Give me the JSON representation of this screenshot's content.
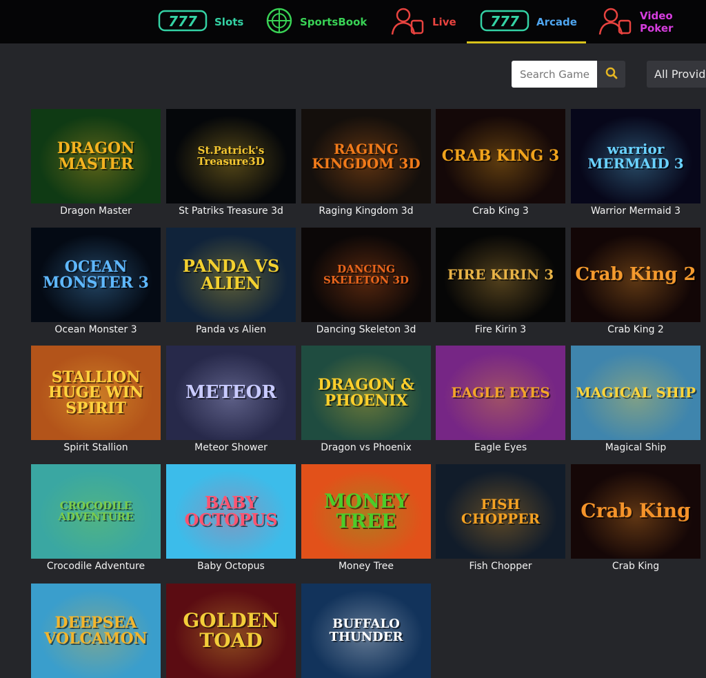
{
  "nav": {
    "items": [
      {
        "label": "Slots",
        "color": "#34d2a4"
      },
      {
        "label": "SportsBook",
        "color": "#39d255"
      },
      {
        "label": "Live",
        "color": "#e8433f"
      },
      {
        "label": "Arcade",
        "color": "#4fa6f0"
      },
      {
        "label": "Video Poker",
        "color": "#d63dde"
      }
    ],
    "active": "Arcade"
  },
  "toolbar": {
    "search_placeholder": "Search Game",
    "provider_label": "All Providers"
  },
  "games": [
    {
      "name": "Dragon Master",
      "art": "DRAGON MASTER",
      "bg": "#0f3a14",
      "accent": "#f4b21f"
    },
    {
      "name": "St Patriks Treasure 3d",
      "art": "St.Patrick's Treasure3D",
      "bg": "#05070a",
      "accent": "#f3c631"
    },
    {
      "name": "Raging Kingdom 3d",
      "art": "RAGING KINGDOM 3D",
      "bg": "#140f0c",
      "accent": "#f07a1a"
    },
    {
      "name": "Crab King 3",
      "art": "CRAB KING 3",
      "bg": "#140808",
      "accent": "#f0a31c"
    },
    {
      "name": "Warrior Mermaid 3",
      "art": "warrior MERMAID 3",
      "bg": "#07071a",
      "accent": "#6ad2ff"
    },
    {
      "name": "Ocean Monster 3",
      "art": "OCEAN MONSTER 3",
      "bg": "#040a14",
      "accent": "#5fb8ff"
    },
    {
      "name": "Panda vs Alien",
      "art": "PANDA VS ALIEN",
      "bg": "#10233a",
      "accent": "#f3d02f"
    },
    {
      "name": "Dancing Skeleton 3d",
      "art": "DANCING SKELETON 3D",
      "bg": "#0b0707",
      "accent": "#e8651c"
    },
    {
      "name": "Fire Kirin 3",
      "art": "FIRE KIRIN 3",
      "bg": "#060606",
      "accent": "#e8b347"
    },
    {
      "name": "Crab King 2",
      "art": "Crab King 2",
      "bg": "#120606",
      "accent": "#f49a2e"
    },
    {
      "name": "Spirit Stallion",
      "art": "STALLION HUGE WIN SPIRIT",
      "bg": "#b3541a",
      "accent": "#ffd23e"
    },
    {
      "name": "Meteor Shower",
      "art": "METEOR",
      "bg": "#27294a",
      "accent": "#c9cbff"
    },
    {
      "name": "Dragon vs Phoenix",
      "art": "DRAGON & PHOENIX",
      "bg": "#1f4c40",
      "accent": "#ffcf2b"
    },
    {
      "name": "Eagle Eyes",
      "art": "EAGLE EYES",
      "bg": "#762685",
      "accent": "#f2a42a"
    },
    {
      "name": "Magical Ship",
      "art": "MAGICAL SHIP",
      "bg": "#3f85ad",
      "accent": "#ffd43a"
    },
    {
      "name": "Crocodile Adventure",
      "art": "CROCODILE ADVENTURE",
      "bg": "#3aa7a2",
      "accent": "#7ccc4a"
    },
    {
      "name": "Baby Octopus",
      "art": "BABY OCTOPUS",
      "bg": "#3cbcea",
      "accent": "#ff5470"
    },
    {
      "name": "Money Tree",
      "art": "MONEY TREE",
      "bg": "#e2511a",
      "accent": "#4ccc2a"
    },
    {
      "name": "Fish Chopper",
      "art": "FISH CHOPPER",
      "bg": "#111c2a",
      "accent": "#f3a123"
    },
    {
      "name": "Crab King",
      "art": "Crab King",
      "bg": "#150707",
      "accent": "#f4932a"
    },
    {
      "name": "",
      "art": "DEEPSEA VOLCAMON",
      "bg": "#3a9ecc",
      "accent": "#f3b52c"
    },
    {
      "name": "",
      "art": "GOLDEN TOAD",
      "bg": "#5b0c12",
      "accent": "#f3ce3a"
    },
    {
      "name": "",
      "art": "BUFFALO THUNDER",
      "bg": "#12335b",
      "accent": "#ffffff"
    }
  ]
}
